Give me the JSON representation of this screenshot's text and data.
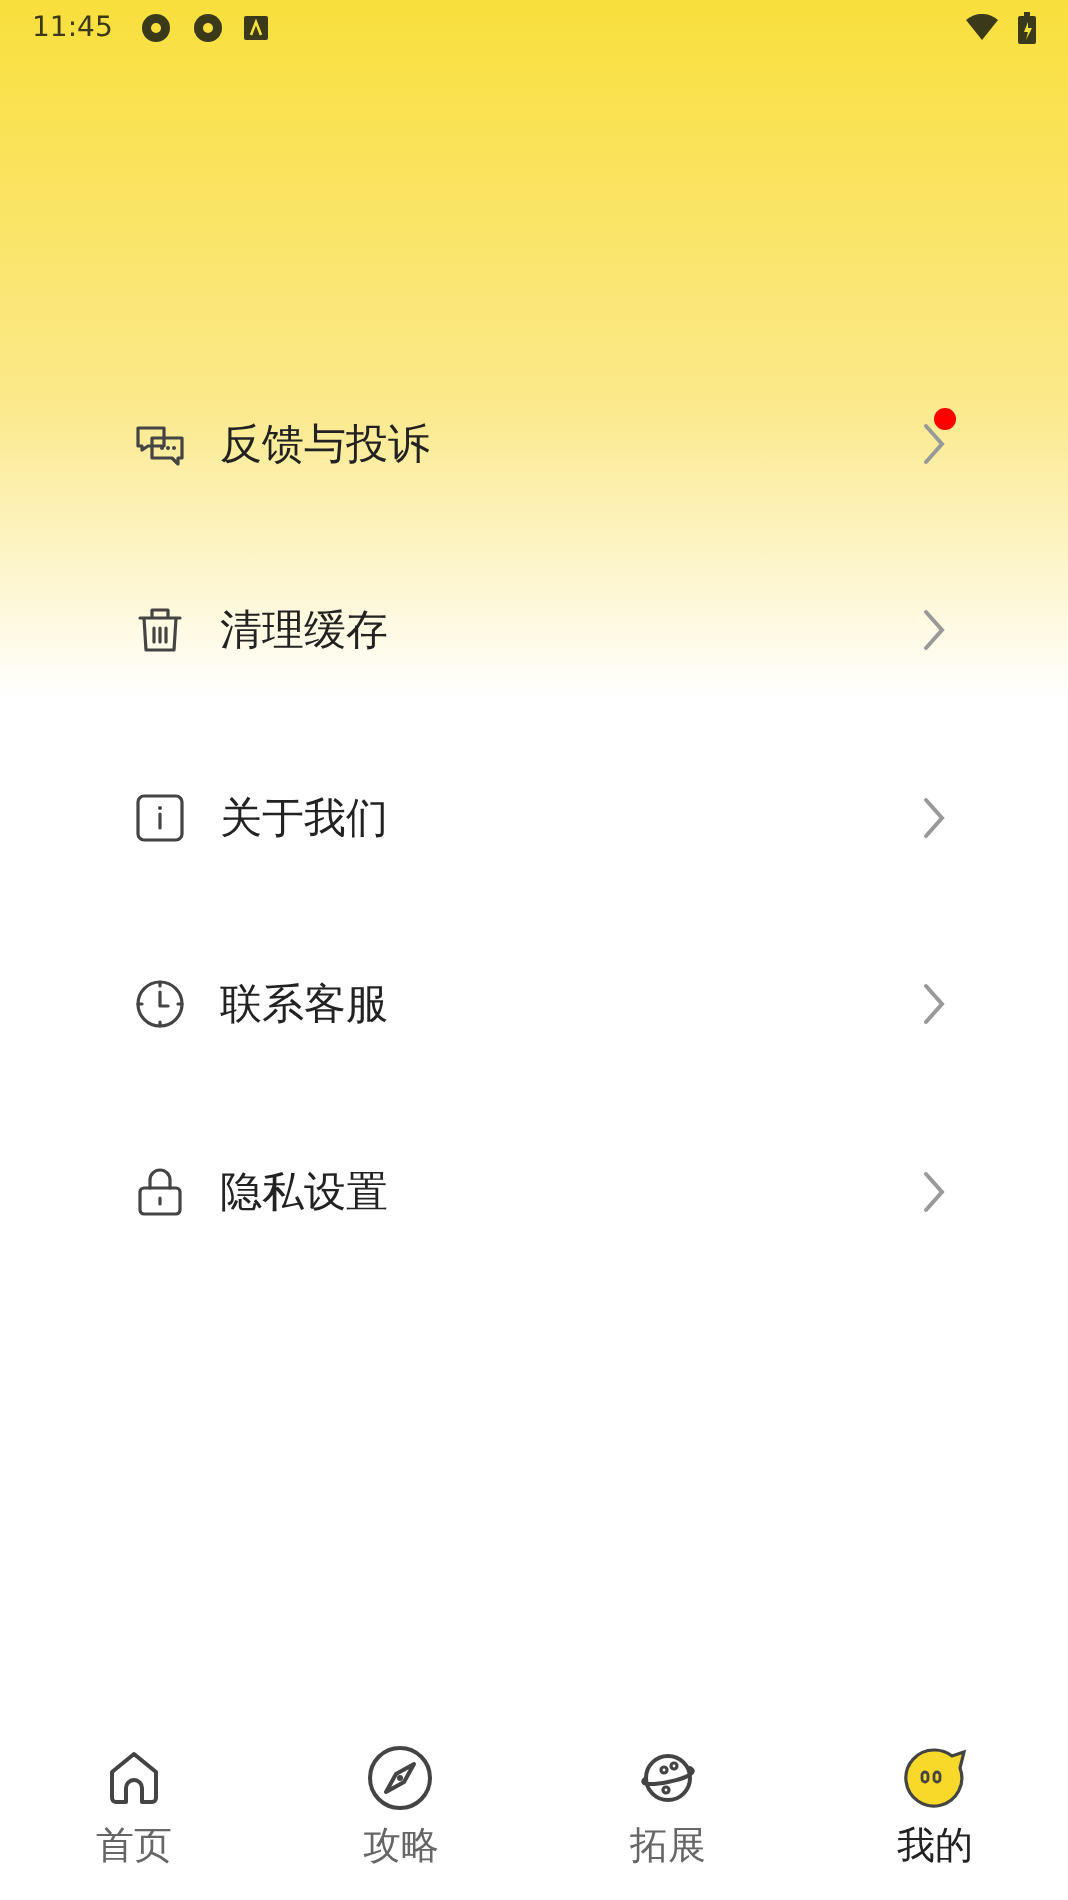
{
  "status_bar": {
    "time": "11:45"
  },
  "menu": [
    {
      "kind": "feedback",
      "label": "反馈与投诉",
      "badge": true
    },
    {
      "kind": "trash",
      "label": "清理缓存",
      "badge": false
    },
    {
      "kind": "info",
      "label": "关于我们",
      "badge": false
    },
    {
      "kind": "clock",
      "label": "联系客服",
      "badge": false
    },
    {
      "kind": "lock",
      "label": "隐私设置",
      "badge": false
    }
  ],
  "tabs": [
    {
      "kind": "home",
      "label": "首页",
      "selected": false
    },
    {
      "kind": "compass",
      "label": "攻略",
      "selected": false
    },
    {
      "kind": "planet",
      "label": "拓展",
      "selected": false
    },
    {
      "kind": "mine",
      "label": "我的",
      "selected": true
    }
  ]
}
